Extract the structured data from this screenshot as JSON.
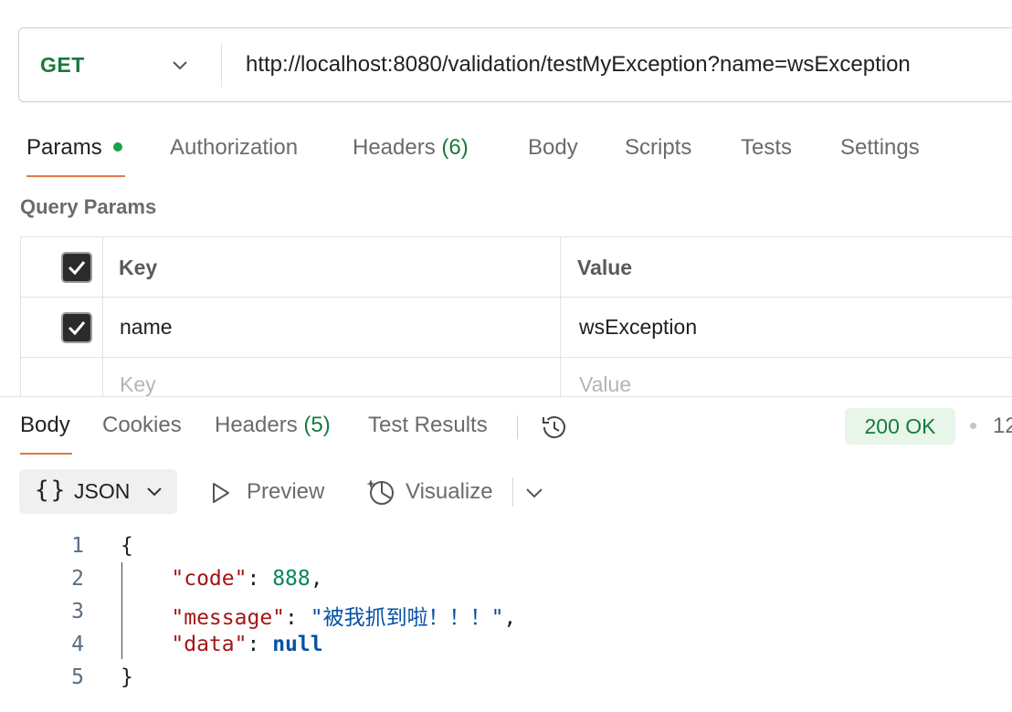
{
  "request": {
    "method": "GET",
    "url": "http://localhost:8080/validation/testMyException?name=wsException"
  },
  "request_tabs": [
    {
      "label": "Params"
    },
    {
      "label": "Authorization"
    },
    {
      "label": "Headers",
      "count": "(6)"
    },
    {
      "label": "Body"
    },
    {
      "label": "Scripts"
    },
    {
      "label": "Tests"
    },
    {
      "label": "Settings"
    }
  ],
  "query_params": {
    "title": "Query Params",
    "header_key": "Key",
    "header_value": "Value",
    "rows": [
      {
        "key": "name",
        "value": "wsException",
        "checked": true
      }
    ],
    "placeholder_key": "Key",
    "placeholder_value": "Value"
  },
  "response_tabs": [
    {
      "label": "Body"
    },
    {
      "label": "Cookies"
    },
    {
      "label": "Headers",
      "count": "(5)"
    },
    {
      "label": "Test Results"
    }
  ],
  "response_status": {
    "badge": "200 OK",
    "time": "12"
  },
  "format_toolbar": {
    "braces": "{}",
    "format": "JSON",
    "preview": "Preview",
    "visualize": "Visualize"
  },
  "code": {
    "line_numbers": [
      "1",
      "2",
      "3",
      "4",
      "5"
    ],
    "open_brace": "{",
    "close_brace": "}",
    "key_code": "\"code\"",
    "val_code": "888",
    "key_message": "\"message\"",
    "val_message": "\"被我抓到啦！！！\"",
    "key_data": "\"data\"",
    "val_data": "null"
  },
  "colors": {
    "method": "#177a3c",
    "accent_underline": "#e07a4a",
    "status_bg": "#e8f6ea",
    "status_text": "#177a3c",
    "json_key": "#a31515",
    "json_number": "#098658",
    "json_string": "#0451a5"
  },
  "icons": [
    "chevron-down-icon",
    "history-icon",
    "preview-play-icon",
    "visualize-icon",
    "checkbox-checked-icon"
  ]
}
